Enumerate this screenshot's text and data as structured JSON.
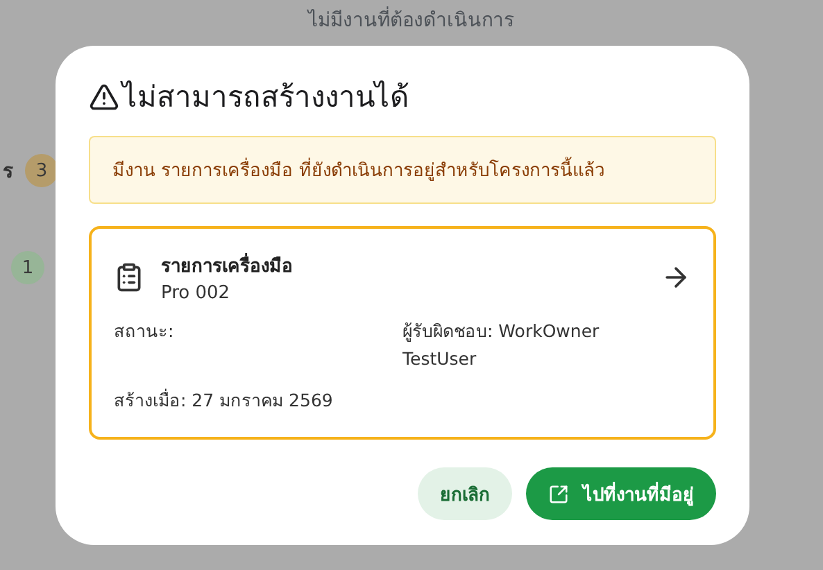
{
  "background": {
    "heading": "ไม่มีงานที่ต้องดำเนินการ",
    "rows": [
      {
        "label": "ร",
        "count": "3",
        "color": "#b59c6a"
      },
      {
        "count": "1",
        "color": "#97b597"
      }
    ]
  },
  "dialog": {
    "title": "ไม่สามารถสร้างงานได้",
    "alert": "มีงาน รายการเครื่องมือ ที่ยังดำเนินการอยู่สำหรับโครงการนี้แล้ว",
    "card": {
      "title": "รายการเครื่องมือ",
      "code": "Pro 002",
      "status": "สถานะ:",
      "owner": "ผู้รับผิดชอบ: WorkOwner TestUser",
      "created": "สร้างเมื่อ: 27 มกราคม 2569"
    },
    "buttons": [
      {
        "label": "ยกเลิก",
        "kind": "secondary"
      },
      {
        "label": "ไปที่งานที่มีอยู่",
        "kind": "primary"
      }
    ]
  }
}
